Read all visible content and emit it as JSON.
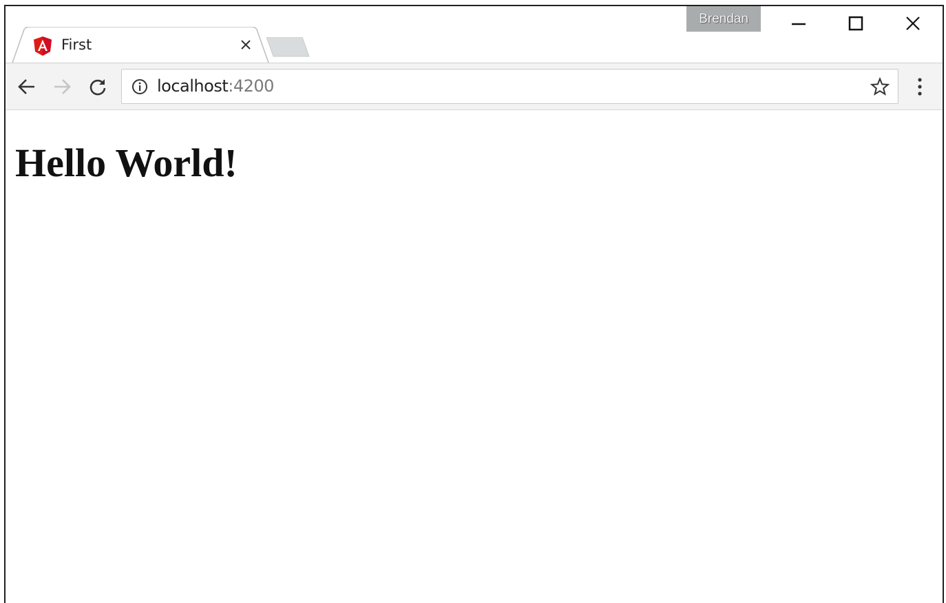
{
  "tab": {
    "title": "First",
    "favicon": "angular-icon",
    "favicon_letter": "A"
  },
  "profile": {
    "name": "Brendan"
  },
  "window_controls": {
    "minimize": "minimize-icon",
    "maximize": "maximize-icon",
    "close": "close-icon"
  },
  "toolbar": {
    "back": "arrow-left-icon",
    "forward": "arrow-right-icon",
    "reload": "reload-icon",
    "menu": "more-vertical-icon"
  },
  "omnibox": {
    "site_icon": "info-icon",
    "host": "localhost",
    "port": ":4200",
    "bookmark": "star-icon"
  },
  "page": {
    "heading": "Hello World!"
  },
  "colors": {
    "angular_red": "#dd1b16",
    "profile_bg": "#a9acad",
    "toolbar_bg": "#f3f3f3"
  }
}
